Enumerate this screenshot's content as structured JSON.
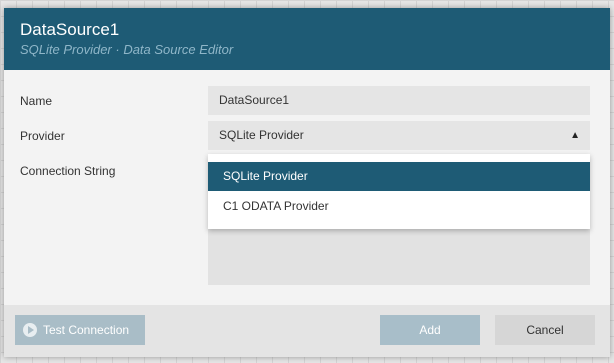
{
  "dialog": {
    "title": "DataSource1",
    "subtitle": "SQLite Provider · Data Source Editor"
  },
  "form": {
    "name_label": "Name",
    "name_value": "DataSource1",
    "provider_label": "Provider",
    "provider_value": "SQLite Provider",
    "connection_label": "Connection String"
  },
  "dropdown": {
    "options": [
      {
        "label": "SQLite Provider",
        "selected": true
      },
      {
        "label": "C1 ODATA Provider",
        "selected": false
      }
    ]
  },
  "footer": {
    "test_label": "Test Connection",
    "add_label": "Add",
    "cancel_label": "Cancel"
  },
  "icons": {
    "test": "play-circle-icon",
    "provider_caret": "chevron-up-icon"
  },
  "colors": {
    "accent": "#1e5b75",
    "header_subtitle": "#8fb6c8",
    "button_disabled": "#a9bdc7"
  }
}
